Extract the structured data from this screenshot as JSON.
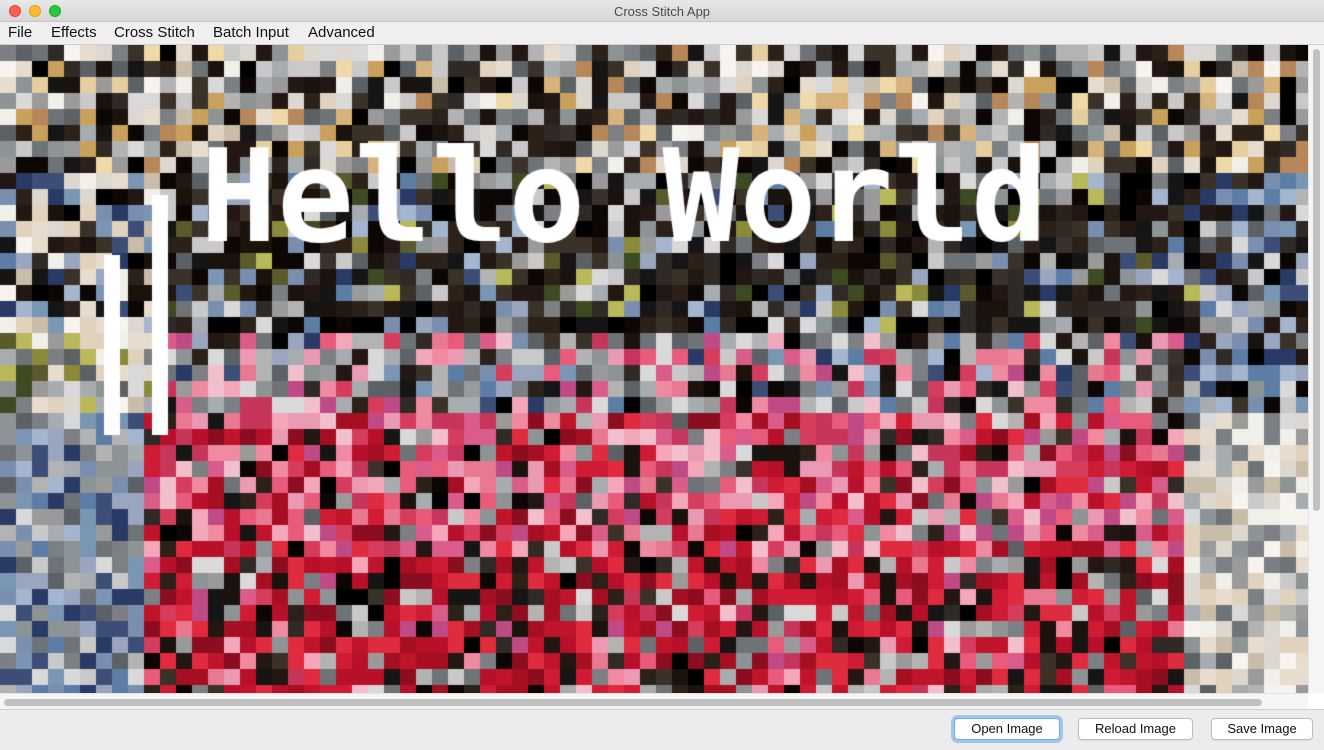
{
  "window": {
    "title": "Cross Stitch App"
  },
  "menu": [
    "File",
    "Effects",
    "Cross Stitch",
    "Batch Input",
    "Advanced"
  ],
  "canvas": {
    "overlay_text": "Hello World",
    "overlay_color": "#ffffff"
  },
  "buttons": {
    "open": "Open Image",
    "reload": "Reload Image",
    "save": "Save Image"
  }
}
